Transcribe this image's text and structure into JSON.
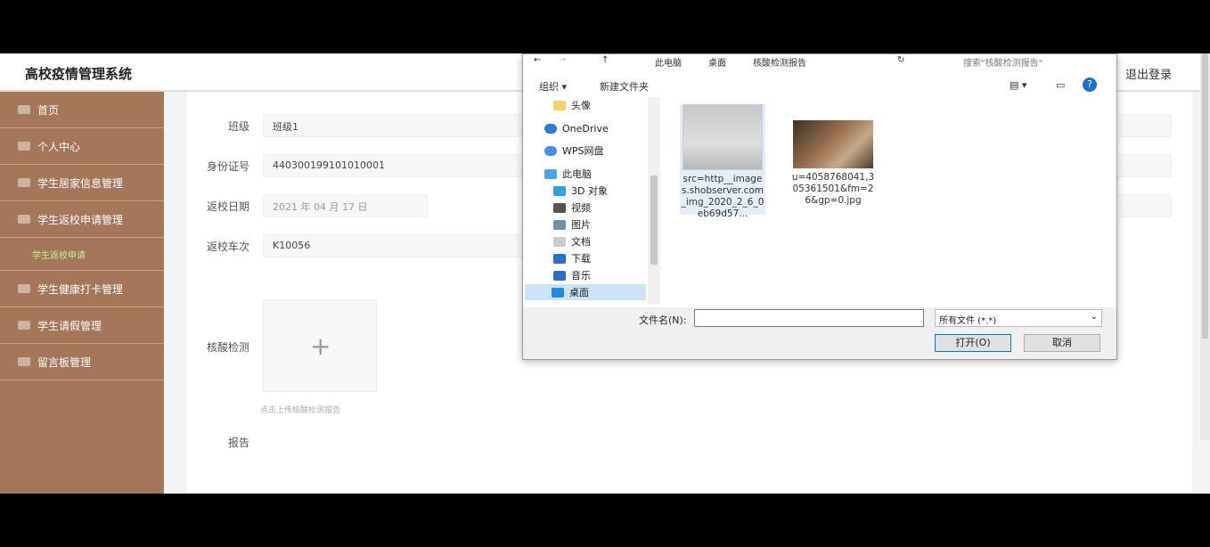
{
  "app": {
    "title": "高校疫情管理系统",
    "logout": "退出登录"
  },
  "sidebar": {
    "items": [
      {
        "label": "首页"
      },
      {
        "label": "个人中心"
      },
      {
        "label": "学生居家信息管理"
      },
      {
        "label": "学生返校申请管理"
      },
      {
        "label": "学生返校申请"
      },
      {
        "label": "学生健康打卡管理"
      },
      {
        "label": "学生请假管理"
      },
      {
        "label": "留言板管理"
      }
    ]
  },
  "form": {
    "class_label": "班级",
    "class_value": "班级1",
    "id_label": "身份证号",
    "id_value": "440300199101010001",
    "date_label": "返校日期",
    "date_value": "2021 年 04 月 17 日",
    "train_label": "返校车次",
    "train_value": "K10056",
    "test_label": "核酸检测",
    "upload_hint": "点击上传核酸检测报告",
    "report_label": "报告"
  },
  "dialog": {
    "breadcrumb": [
      "此电脑",
      "桌面",
      "核酸检测报告"
    ],
    "search_placeholder": "搜索\"核酸检测报告\"",
    "organize": "组织 ▾",
    "new_folder": "新建文件夹",
    "nav": [
      "头像",
      "OneDrive",
      "WPS网盘",
      "此电脑",
      "3D 对象",
      "视频",
      "图片",
      "文档",
      "下载",
      "音乐",
      "桌面"
    ],
    "files": [
      {
        "name": "src=http__images.shobserver.com_img_2020_2_6_0eb69d57..."
      },
      {
        "name": "u=4058768041,305361501&fm=26&gp=0.jpg"
      }
    ],
    "filename_label": "文件名(N):",
    "filetype": "所有文件 (*.*)",
    "open": "打开(O)",
    "cancel": "取消"
  },
  "colors": {
    "sidebar": "#a5765a",
    "accent": "#0078d7"
  }
}
